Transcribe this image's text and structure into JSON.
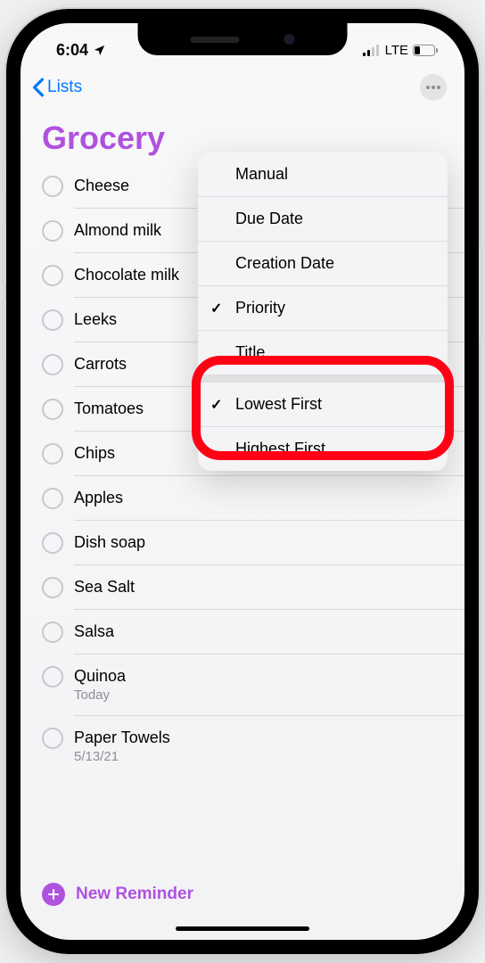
{
  "status": {
    "time": "6:04",
    "network": "LTE"
  },
  "nav": {
    "back_label": "Lists"
  },
  "list": {
    "title": "Grocery"
  },
  "reminders": [
    {
      "title": "Cheese",
      "sub": ""
    },
    {
      "title": "Almond milk",
      "sub": ""
    },
    {
      "title": "Chocolate milk",
      "sub": ""
    },
    {
      "title": "Leeks",
      "sub": ""
    },
    {
      "title": "Carrots",
      "sub": ""
    },
    {
      "title": "Tomatoes",
      "sub": ""
    },
    {
      "title": "Chips",
      "sub": ""
    },
    {
      "title": "Apples",
      "sub": ""
    },
    {
      "title": "Dish soap",
      "sub": ""
    },
    {
      "title": "Sea Salt",
      "sub": ""
    },
    {
      "title": "Salsa",
      "sub": ""
    },
    {
      "title": "Quinoa",
      "sub": "Today"
    },
    {
      "title": "Paper Towels",
      "sub": "5/13/21"
    }
  ],
  "menu": {
    "section1": [
      {
        "label": "Manual",
        "checked": false
      },
      {
        "label": "Due Date",
        "checked": false
      },
      {
        "label": "Creation Date",
        "checked": false
      },
      {
        "label": "Priority",
        "checked": true
      },
      {
        "label": "Title",
        "checked": false
      }
    ],
    "section2": [
      {
        "label": "Lowest First",
        "checked": true
      },
      {
        "label": "Highest First",
        "checked": false
      }
    ]
  },
  "footer": {
    "new_reminder": "New Reminder"
  }
}
